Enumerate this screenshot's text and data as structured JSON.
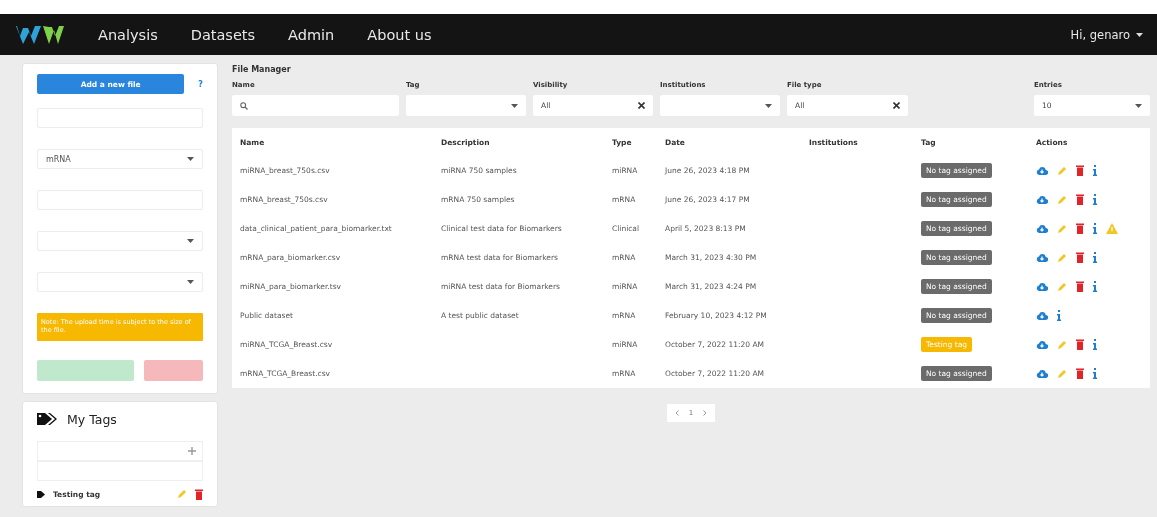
{
  "navbar": {
    "links": [
      {
        "label": "Analysis"
      },
      {
        "label": "Datasets"
      },
      {
        "label": "Admin"
      },
      {
        "label": "About us"
      }
    ],
    "user": "Hi, genaro"
  },
  "upload_form": {
    "button": "Add a new file",
    "help": "?",
    "fields": [
      {
        "kind": "input"
      },
      {
        "kind": "select",
        "value": "mRNA"
      },
      {
        "kind": "input"
      },
      {
        "kind": "select"
      },
      {
        "kind": "select"
      }
    ],
    "note": "Note: The upload time is subject to the size of the file."
  },
  "tags_panel": {
    "title": "My Tags",
    "tags": [
      {
        "label": "Testing tag"
      }
    ]
  },
  "file_manager": {
    "title": "File Manager",
    "filters": [
      {
        "label": "Name",
        "kind": "search"
      },
      {
        "label": "Tag",
        "kind": "select"
      },
      {
        "label": "Visibility",
        "kind": "clearable",
        "value": "All"
      },
      {
        "label": "Institutions",
        "kind": "select"
      },
      {
        "label": "File type",
        "kind": "clearable",
        "value": "All"
      },
      {
        "label": "Entries",
        "kind": "select",
        "value": "10"
      }
    ],
    "table": {
      "columns": [
        "Name",
        "Description",
        "Type",
        "Date",
        "Institutions",
        "Tag",
        "Actions"
      ],
      "rows": [
        {
          "name": "miRNA_breast_750s.csv",
          "description": "miRNA 750 samples",
          "type": "miRNA",
          "date": "June 26, 2023 4:18 PM",
          "tag": {
            "label": "No tag assigned",
            "color": "#6b6b6b"
          },
          "actions": [
            {
              "kind": "download"
            },
            {
              "kind": "edit"
            },
            {
              "kind": "delete"
            },
            {
              "kind": "info"
            }
          ]
        },
        {
          "name": "mRNA_breast_750s.csv",
          "description": "mRNA 750 samples",
          "type": "mRNA",
          "date": "June 26, 2023 4:17 PM",
          "tag": {
            "label": "No tag assigned",
            "color": "#6b6b6b"
          },
          "actions": [
            {
              "kind": "download"
            },
            {
              "kind": "edit"
            },
            {
              "kind": "delete"
            },
            {
              "kind": "info"
            }
          ]
        },
        {
          "name": "data_clinical_patient_para_biomarker.txt",
          "description": "Clinical test data for Biomarkers",
          "type": "Clinical",
          "date": "April 5, 2023 8:13 PM",
          "tag": {
            "label": "No tag assigned",
            "color": "#6b6b6b"
          },
          "actions": [
            {
              "kind": "download"
            },
            {
              "kind": "edit"
            },
            {
              "kind": "delete"
            },
            {
              "kind": "info"
            },
            {
              "kind": "warning"
            }
          ]
        },
        {
          "name": "mRNA_para_biomarker.csv",
          "description": "mRNA test data for Biomarkers",
          "type": "mRNA",
          "date": "March 31, 2023 4:30 PM",
          "tag": {
            "label": "No tag assigned",
            "color": "#6b6b6b"
          },
          "actions": [
            {
              "kind": "download"
            },
            {
              "kind": "edit"
            },
            {
              "kind": "delete"
            },
            {
              "kind": "info"
            }
          ]
        },
        {
          "name": "miRNA_para_biomarker.tsv",
          "description": "miRNA test data for Biomarkers",
          "type": "miRNA",
          "date": "March 31, 2023 4:24 PM",
          "tag": {
            "label": "No tag assigned",
            "color": "#6b6b6b"
          },
          "actions": [
            {
              "kind": "download"
            },
            {
              "kind": "edit"
            },
            {
              "kind": "delete"
            },
            {
              "kind": "info"
            }
          ]
        },
        {
          "name": "Public dataset",
          "description": "A test public dataset",
          "type": "mRNA",
          "date": "February 10, 2023 4:12 PM",
          "tag": {
            "label": "No tag assigned",
            "color": "#6b6b6b"
          },
          "actions": [
            {
              "kind": "download"
            },
            {
              "kind": "info"
            }
          ]
        },
        {
          "name": "miRNA_TCGA_Breast.csv",
          "type": "miRNA",
          "date": "October 7, 2022 11:20 AM",
          "tag": {
            "label": "Testing tag",
            "color": "#f6b800"
          },
          "actions": [
            {
              "kind": "download"
            },
            {
              "kind": "edit"
            },
            {
              "kind": "delete"
            },
            {
              "kind": "info"
            }
          ]
        },
        {
          "name": "mRNA_TCGA_Breast.csv",
          "type": "mRNA",
          "date": "October 7, 2022 11:20 AM",
          "tag": {
            "label": "No tag assigned",
            "color": "#6b6b6b"
          },
          "actions": [
            {
              "kind": "download"
            },
            {
              "kind": "edit"
            },
            {
              "kind": "delete"
            },
            {
              "kind": "info"
            }
          ]
        }
      ]
    },
    "pagination": {
      "page": "1"
    }
  }
}
